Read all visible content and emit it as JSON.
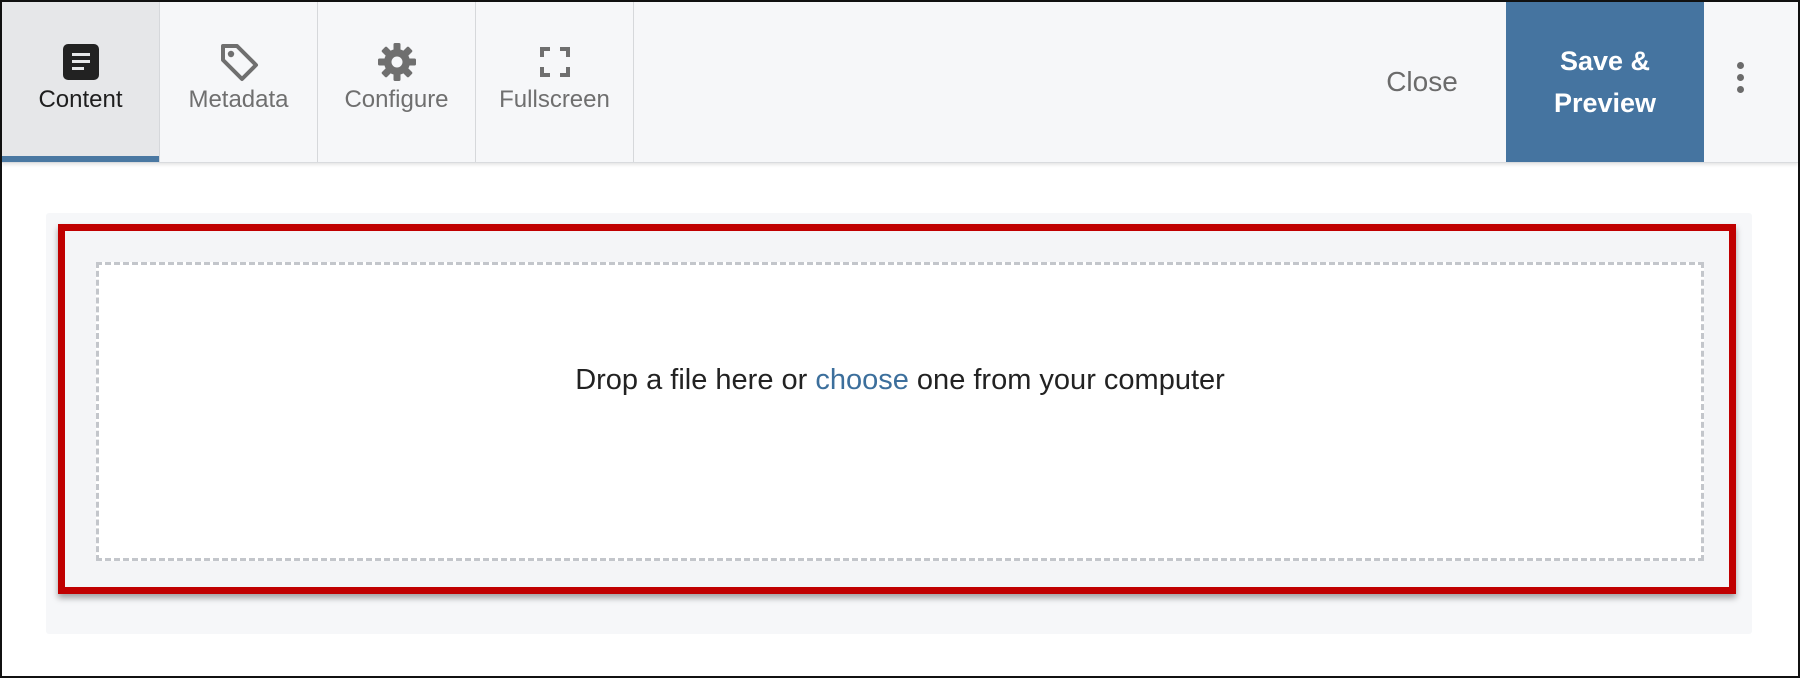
{
  "toolbar": {
    "tabs": [
      {
        "label": "Content",
        "icon": "document-icon",
        "active": true
      },
      {
        "label": "Metadata",
        "icon": "tag-icon",
        "active": false
      },
      {
        "label": "Configure",
        "icon": "gear-icon",
        "active": false
      },
      {
        "label": "Fullscreen",
        "icon": "fullscreen-icon",
        "active": false
      }
    ],
    "close_label": "Close",
    "save_line1": "Save &",
    "save_line2": "Preview",
    "more_icon": "more-vertical-icon"
  },
  "dropzone": {
    "text_before": "Drop a file here or ",
    "link_text": "choose",
    "text_after": " one from your computer"
  },
  "colors": {
    "accent": "#4574a0",
    "highlight_border": "#c00000",
    "link": "#3c6f9c",
    "toolbar_bg": "#f6f7f9"
  }
}
